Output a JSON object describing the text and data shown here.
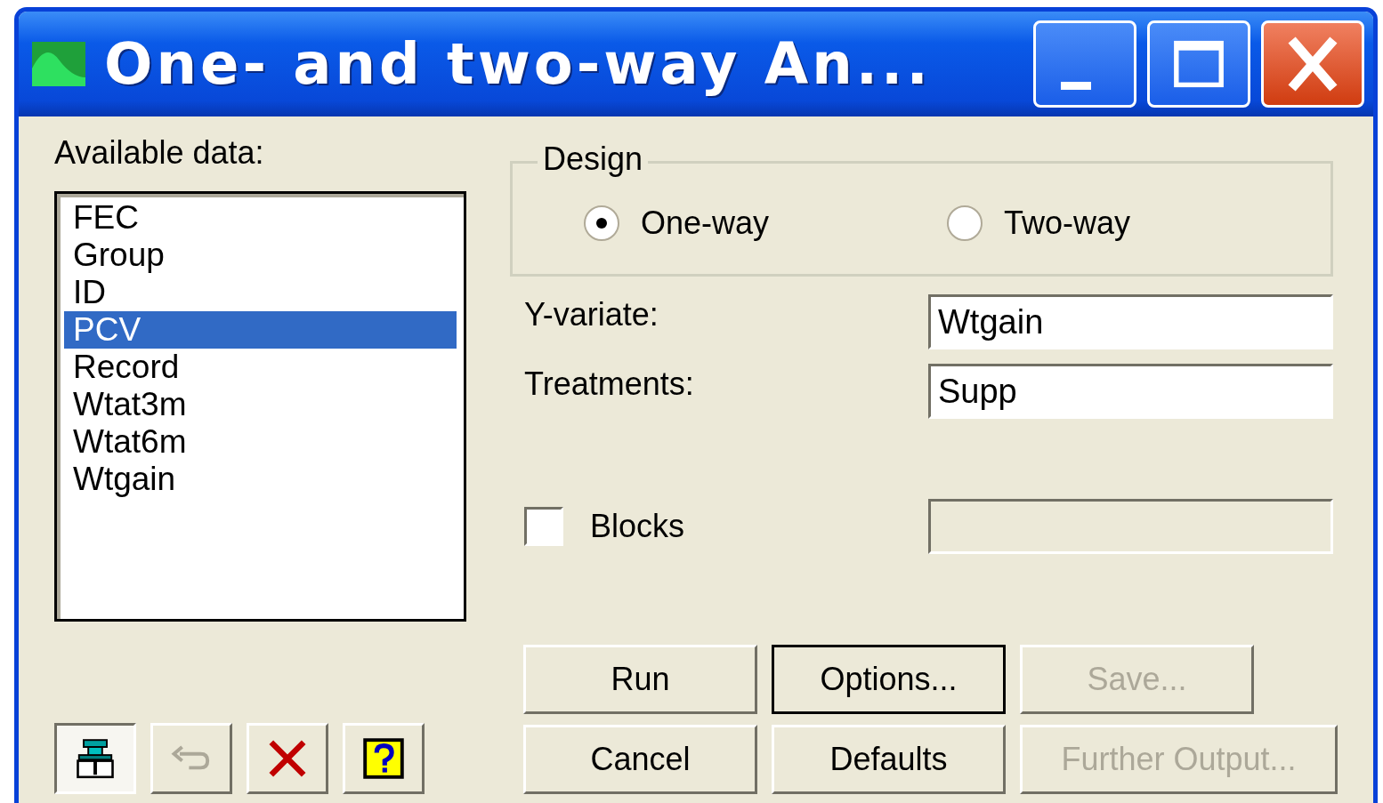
{
  "window": {
    "title": "One- and two-way An..."
  },
  "available_data": {
    "label": "Available data:",
    "items": [
      {
        "label": "FEC",
        "selected": false
      },
      {
        "label": "Group",
        "selected": false
      },
      {
        "label": "ID",
        "selected": false
      },
      {
        "label": "PCV",
        "selected": true
      },
      {
        "label": "Record",
        "selected": false
      },
      {
        "label": "Wtat3m",
        "selected": false
      },
      {
        "label": "Wtat6m",
        "selected": false
      },
      {
        "label": "Wtgain",
        "selected": false
      }
    ]
  },
  "design": {
    "title": "Design",
    "options": [
      {
        "label": "One-way",
        "selected": true
      },
      {
        "label": "Two-way",
        "selected": false
      }
    ]
  },
  "fields": [
    {
      "label": "Y-variate:",
      "value": "Wtgain"
    },
    {
      "label": "Treatments:",
      "value": "Supp"
    }
  ],
  "blocks": {
    "label": "Blocks",
    "checked": false
  },
  "buttons": [
    {
      "label": "Run",
      "disabled": false,
      "default": false
    },
    {
      "label": "Options...",
      "disabled": false,
      "default": true
    },
    {
      "label": "Save...",
      "disabled": true,
      "default": false
    },
    {
      "label": "Cancel",
      "disabled": false,
      "default": false
    },
    {
      "label": "Defaults",
      "disabled": false,
      "default": false
    },
    {
      "label": "Further Output...",
      "disabled": true,
      "default": false
    }
  ],
  "tools": [
    {
      "kind": "pin",
      "pressed": true,
      "disabled": false
    },
    {
      "kind": "undo",
      "pressed": false,
      "disabled": true
    },
    {
      "kind": "delete",
      "pressed": false,
      "disabled": false
    },
    {
      "kind": "help",
      "pressed": false,
      "disabled": false
    }
  ]
}
